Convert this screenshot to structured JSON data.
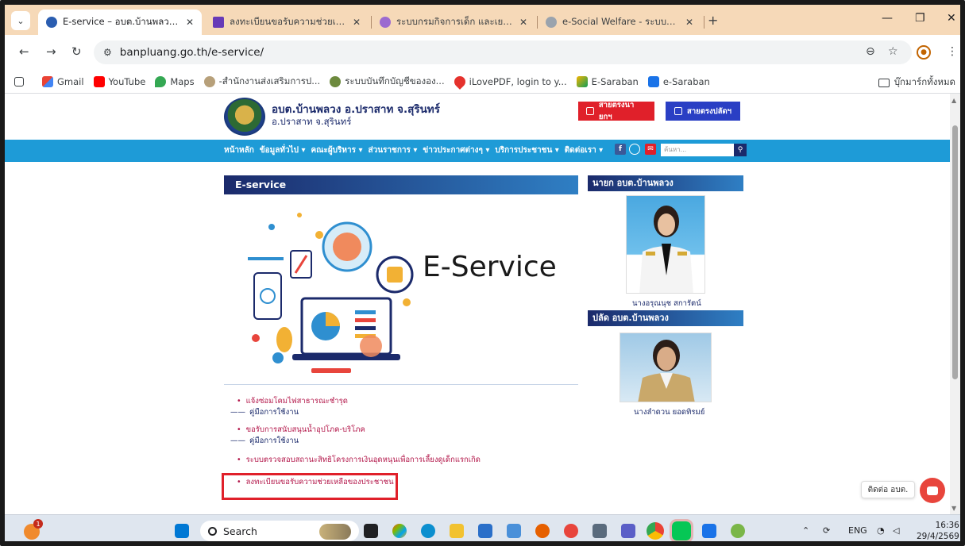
{
  "browser": {
    "tabs": [
      {
        "title": "E-service – อบต.บ้านพลวง อ.ปราสา",
        "active": true
      },
      {
        "title": "ลงทะเบียนขอรับความช่วยเหลือของป"
      },
      {
        "title": "ระบบกรมกิจการเด็ก และเยาวชน (ดย."
      },
      {
        "title": "e-Social Welfare - ระบบบูรณาการ"
      }
    ],
    "url": "banpluang.go.th/e-service/",
    "bookmarks": [
      {
        "label": "Gmail"
      },
      {
        "label": "YouTube"
      },
      {
        "label": "Maps"
      },
      {
        "label": "-สำนักงานส่งเสริมการป..."
      },
      {
        "label": "ระบบบันทึกบัญชีขององ..."
      },
      {
        "label": "iLovePDF, login to y..."
      },
      {
        "label": "E-Saraban"
      },
      {
        "label": "e-Saraban"
      }
    ],
    "all_bookmarks": "บุ๊กมาร์กทั้งหมด"
  },
  "site": {
    "name": "อบต.บ้านพลวง อ.ปราสาท จ.สุรินทร์",
    "sub": "อ.ปราสาท จ.สุรินทร์",
    "hot_buttons": [
      "สายตรงนายกฯ",
      "สายตรงปลัดฯ"
    ],
    "nav": [
      "หน้าหลัก",
      "ข้อมูลทั่วไป ▾",
      "คณะผู้บริหาร ▾",
      "ส่วนราชการ ▾",
      "ข่าวประกาศต่างๆ ▾",
      "บริการประชาชน ▾",
      "ติดต่อเรา ▾"
    ],
    "search_placeholder": "ค้นหา..."
  },
  "panel": {
    "title": "E-service",
    "image_text": "E-Service"
  },
  "links": [
    {
      "text": "แจ้งซ่อมโคมไฟสาธารณะชำรุด"
    },
    {
      "text": "คู่มือการใช้งาน",
      "manual": true
    },
    {
      "text": "ขอรับการสนับสนุนน้ำอุปโภค-บริโภค"
    },
    {
      "text": "คู่มือการใช้งาน",
      "manual": true
    },
    {
      "text": "ระบบตรวจสอบสถานะสิทธิโครงการเงินอุดหนุนเพื่อการเลี้ยงดูเด็กแรกเกิด"
    },
    {
      "text": "ลงทะเบียนขอรับความช่วยเหลือของประชาชน"
    }
  ],
  "sidebar": {
    "mayor_head": "นายก อบต.บ้านพลวง",
    "mayor_name": "นางอรุณนุช สการัตน์",
    "clerk_head": "ปลัด อบต.บ้านพลวง",
    "clerk_name": "นางลำดวน ยอดทิรมย์"
  },
  "chat_label": "ติดต่อ อบต.",
  "taskbar": {
    "search": "Search",
    "badge": "1",
    "lang": "ENG",
    "time": "16:36",
    "date": "29/4/2569"
  },
  "colors": {
    "tabstrip": "#f6d9b8",
    "site_nav": "#1e9bd7",
    "brand_navy": "#1b2a6b",
    "link": "#b3174a",
    "highlight": "#e0202a",
    "hot_red": "#e0202a",
    "hot_blue": "#2a3fc4"
  }
}
